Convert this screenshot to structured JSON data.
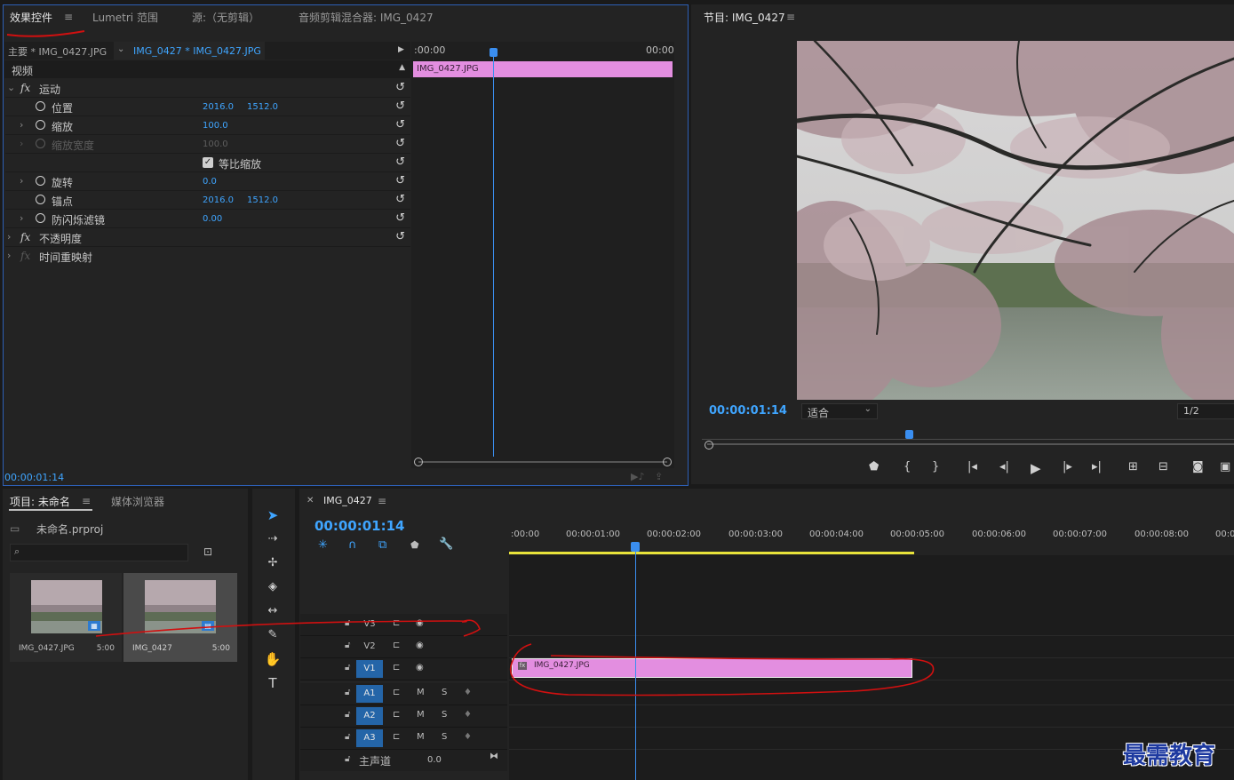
{
  "effects_panel": {
    "tabs": [
      "效果控件",
      "Lumetri 范围",
      "源:（无剪辑）",
      "音频剪辑混合器: IMG_0427"
    ],
    "menu": "≡",
    "clip_master": "主要 * IMG_0427.JPG",
    "clip_seq": "IMG_0427 * IMG_0427.JPG",
    "tl_start": ":00:00",
    "tl_end": "00:00",
    "clip_bar": "IMG_0427.JPG",
    "section_video": "视频",
    "rows": {
      "motion": "运动",
      "position": "位置",
      "position_x": "2016.0",
      "position_y": "1512.0",
      "scale": "缩放",
      "scale_val": "100.0",
      "scale_width": "缩放宽度",
      "scale_width_val": "100.0",
      "uniform": "等比缩放",
      "rotation": "旋转",
      "rotation_val": "0.0",
      "anchor": "锚点",
      "anchor_x": "2016.0",
      "anchor_y": "1512.0",
      "antiflicker": "防闪烁滤镜",
      "antiflicker_val": "0.00",
      "opacity": "不透明度",
      "time_remap": "时间重映射"
    },
    "timecode": "00:00:01:14"
  },
  "program_monitor": {
    "title": "节目: IMG_0427",
    "timecode": "00:00:01:14",
    "fit": "适合",
    "resolution": "1/2"
  },
  "project_panel": {
    "tabs": [
      "项目: 未命名",
      "媒体浏览器"
    ],
    "file": "未命名.prproj",
    "items": [
      {
        "name": "IMG_0427.JPG",
        "duration": "5:00"
      },
      {
        "name": "IMG_0427",
        "duration": "5:00"
      }
    ]
  },
  "timeline": {
    "sequence": "IMG_0427",
    "timecode": "00:00:01:14",
    "ruler": [
      ":00:00",
      "00:00:01:00",
      "00:00:02:00",
      "00:00:03:00",
      "00:00:04:00",
      "00:00:05:00",
      "00:00:06:00",
      "00:00:07:00",
      "00:00:08:00",
      "00:0"
    ],
    "tracks_video": [
      "V3",
      "V2",
      "V1"
    ],
    "tracks_audio": [
      "A1",
      "A2",
      "A3"
    ],
    "m": "M",
    "s": "S",
    "master": "主声道",
    "master_val": "0.0",
    "clip": "IMG_0427.JPG"
  },
  "watermark": "最需教育",
  "colors": {
    "accent": "#3fa5ff",
    "clip": "#e38ee0",
    "annotation": "#d01010"
  }
}
